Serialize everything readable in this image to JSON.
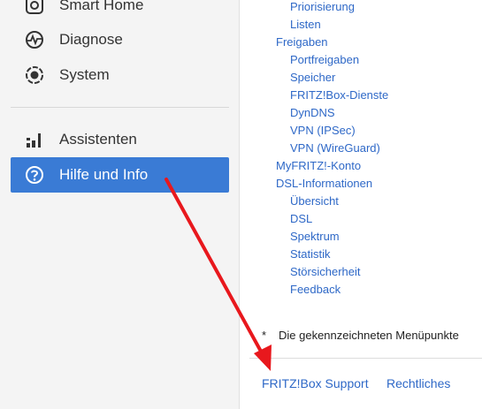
{
  "sidebar": {
    "items": [
      {
        "label": "Smart Home",
        "icon": "smart-home-icon"
      },
      {
        "label": "Diagnose",
        "icon": "diagnose-icon"
      },
      {
        "label": "System",
        "icon": "system-icon"
      },
      {
        "label": "Assistenten",
        "icon": "assistant-icon"
      },
      {
        "label": "Hilfe und Info",
        "icon": "help-icon",
        "active": true
      }
    ]
  },
  "content": {
    "links": [
      {
        "label": "Priorisierung",
        "level": 2
      },
      {
        "label": "Listen",
        "level": 2
      },
      {
        "label": "Freigaben",
        "level": 1
      },
      {
        "label": "Portfreigaben",
        "level": 2
      },
      {
        "label": "Speicher",
        "level": 2
      },
      {
        "label": "FRITZ!Box-Dienste",
        "level": 2
      },
      {
        "label": "DynDNS",
        "level": 2
      },
      {
        "label": "VPN (IPSec)",
        "level": 2
      },
      {
        "label": "VPN (WireGuard)",
        "level": 2
      },
      {
        "label": "MyFRITZ!-Konto",
        "level": 1
      },
      {
        "label": "DSL-Informationen",
        "level": 1
      },
      {
        "label": "Übersicht",
        "level": 2
      },
      {
        "label": "DSL",
        "level": 2
      },
      {
        "label": "Spektrum",
        "level": 2
      },
      {
        "label": "Statistik",
        "level": 2
      },
      {
        "label": "Störsicherheit",
        "level": 2
      },
      {
        "label": "Feedback",
        "level": 2
      }
    ],
    "footnote": {
      "marker": "*",
      "text": "Die gekennzeichneten Menüpunkte"
    }
  },
  "footer": {
    "support_label": "FRITZ!Box Support",
    "legal_label": "Rechtliches"
  },
  "colors": {
    "accent": "#3a7bd5",
    "link": "#2e68c7",
    "annotation_arrow": "#e8181d"
  }
}
